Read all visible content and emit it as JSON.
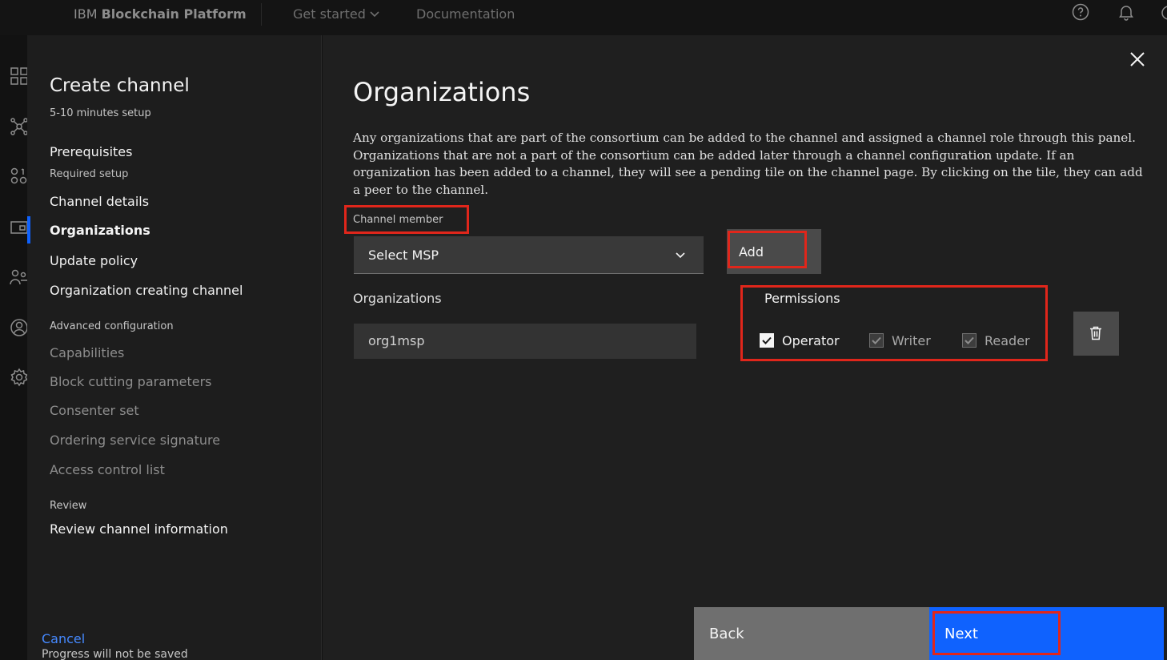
{
  "header": {
    "brand_prefix": "IBM",
    "brand_name": "Blockchain Platform",
    "nav_get_started": "Get started",
    "nav_documentation": "Documentation"
  },
  "rail_icons": [
    "dashboard-icon",
    "nodes-icon",
    "organizations-icon",
    "channels-icon",
    "users-icon",
    "account-icon",
    "settings-icon"
  ],
  "wizard": {
    "title": "Create channel",
    "subtitle": "5-10 minutes setup",
    "steps": {
      "prerequisites": "Prerequisites",
      "prerequisites_sub": "Required setup",
      "channel_details": "Channel details",
      "organizations": "Organizations",
      "update_policy": "Update policy",
      "org_creating_channel": "Organization creating channel",
      "advanced_header": "Advanced configuration",
      "capabilities": "Capabilities",
      "block_cutting": "Block cutting parameters",
      "consenter_set": "Consenter set",
      "ordering_signature": "Ordering service signature",
      "acl": "Access control list",
      "review_header": "Review",
      "review_info": "Review channel information"
    },
    "cancel_label": "Cancel",
    "cancel_note": "Progress will not be saved"
  },
  "main": {
    "title": "Organizations",
    "description": "Any organizations that are part of the consortium can be added to the channel and assigned a channel role through this panel. Organizations that are not a part of the consortium can be added later through a channel configuration update. If an organization has been added to a channel, they will see a pending tile on the channel page. By clicking on the tile, they can add a peer to the channel.",
    "channel_member_label": "Channel member",
    "msp_select_placeholder": "Select MSP",
    "add_button": "Add",
    "organizations_label": "Organizations",
    "organization_value": "org1msp",
    "permissions_label": "Permissions",
    "permissions": [
      {
        "label": "Operator",
        "checked": true,
        "enabled": true
      },
      {
        "label": "Writer",
        "checked": true,
        "enabled": false
      },
      {
        "label": "Reader",
        "checked": true,
        "enabled": false
      }
    ]
  },
  "footer": {
    "back_label": "Back",
    "next_label": "Next"
  },
  "colors": {
    "primary": "#0f62fe",
    "highlight": "#e0261b",
    "link": "#4589ff"
  }
}
